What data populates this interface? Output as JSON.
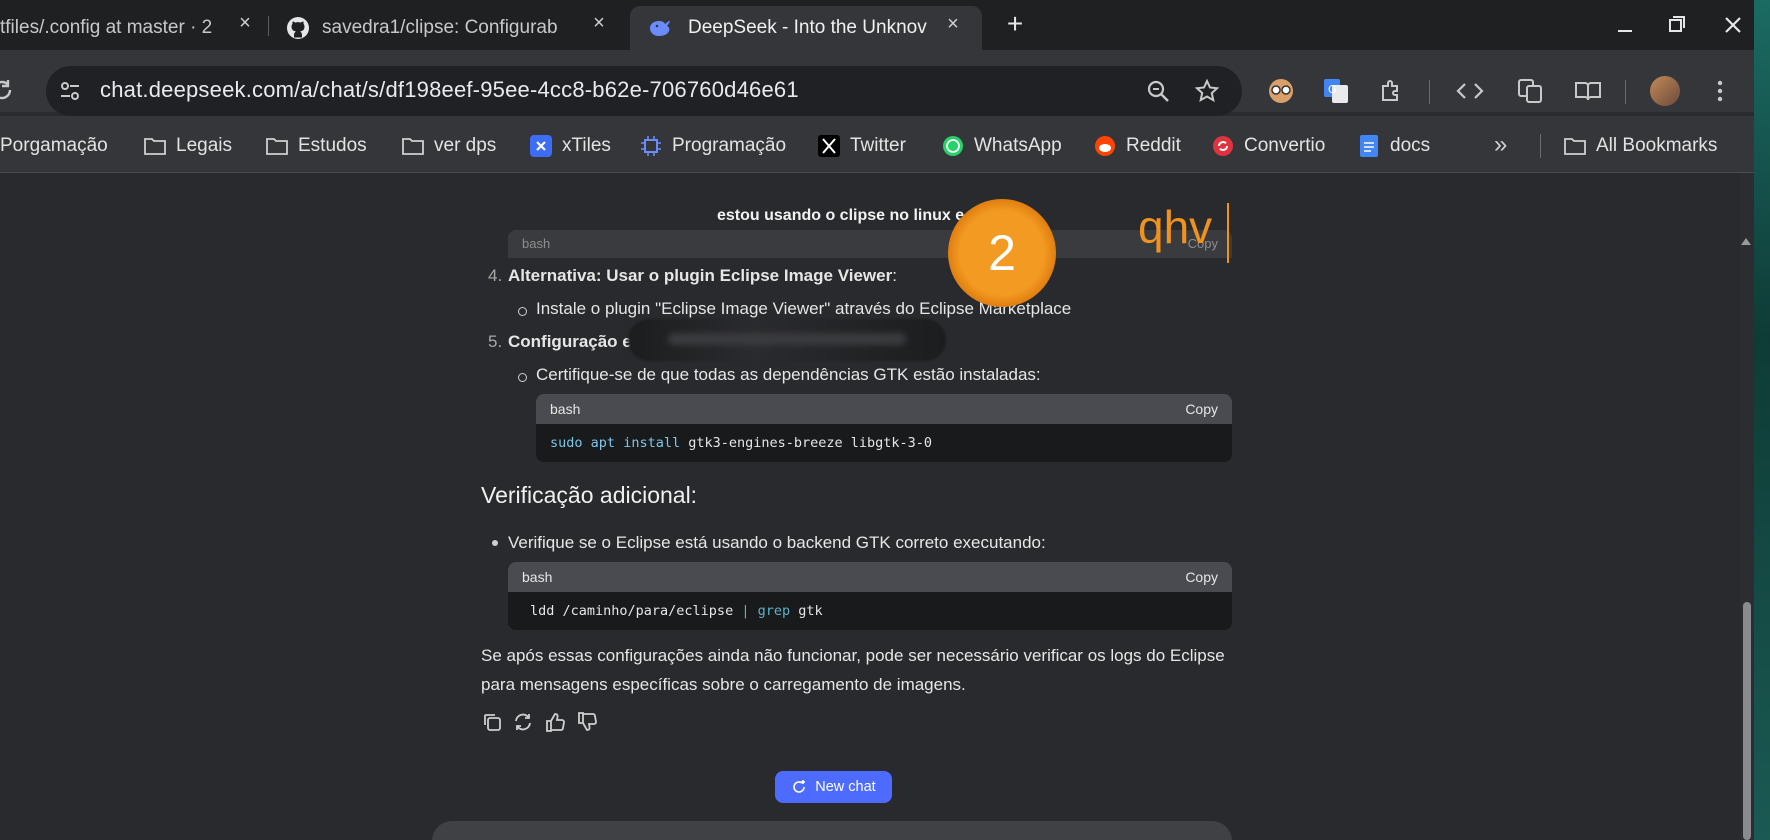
{
  "tabs": [
    {
      "title": "tfiles/.config at master · 2",
      "icon": "none"
    },
    {
      "title": "savedra1/clipse: Configurab",
      "icon": "github-icon"
    },
    {
      "title": "DeepSeek - Into the Unknov",
      "icon": "deepseek-whale-icon",
      "active": true
    }
  ],
  "address_bar": {
    "url": "chat.deepseek.com/a/chat/s/df198eef-95ee-4cc8-b62e-706760d46e61"
  },
  "bookmarks": [
    {
      "label": "Porgamação",
      "icon": "none"
    },
    {
      "label": "Legais",
      "icon": "folder-icon"
    },
    {
      "label": "Estudos",
      "icon": "folder-icon"
    },
    {
      "label": "ver dps",
      "icon": "folder-icon"
    },
    {
      "label": "xTiles",
      "icon": "xtiles-icon"
    },
    {
      "label": "Programação",
      "icon": "chip-icon"
    },
    {
      "label": "Twitter",
      "icon": "x-icon"
    },
    {
      "label": "WhatsApp",
      "icon": "whatsapp-icon"
    },
    {
      "label": "Reddit",
      "icon": "reddit-icon"
    },
    {
      "label": "Convertio",
      "icon": "convertio-icon"
    },
    {
      "label": "docs",
      "icon": "docs-icon"
    }
  ],
  "all_bookmarks_label": "All Bookmarks",
  "chat": {
    "user_prompt_fragment": "estou usando o clipse no linux e",
    "code1_lang": "bash",
    "code1_copy": "Copy",
    "item4_num": "4.",
    "item4_bold": "Alternativa: Usar o plugin Eclipse Image Viewer",
    "item4_colon": ":",
    "item4_sub": "Instale o plugin \"Eclipse Image Viewer\" através do Eclipse Marketplace",
    "item5_num": "5.",
    "item5_bold": "Configuração e",
    "item5_sub": "Certifique-se de que todas as dependências GTK estão instaladas:",
    "code2_lang": "bash",
    "code2_copy": "Copy",
    "code2_cmd1": "sudo",
    "code2_cmd2": "apt",
    "code2_cmd3": "install",
    "code2_rest": " gtk3-engines-breeze libgtk-3-0",
    "heading": "Verificação adicional:",
    "bullet1": "Verifique se o Eclipse está usando o backend GTK correto executando:",
    "code3_lang": "bash",
    "code3_copy": "Copy",
    "code3_part1": "ldd /caminho/para/eclipse ",
    "code3_pipe": "|",
    "code3_grep": " grep",
    "code3_rest": " gtk",
    "para_line1": "Se após essas configurações ainda não funcionar, pode ser necessário verificar os logs do Eclipse",
    "para_line2": "para mensagens específicas sobre o carregamento de imagens.",
    "new_chat_label": "New chat"
  },
  "overlay": {
    "badge_number": "2",
    "typed_text": "qhv"
  },
  "colors": {
    "accent": "#4d6bfe",
    "badge": "#f0921e",
    "overlay_text": "#f0921e"
  }
}
